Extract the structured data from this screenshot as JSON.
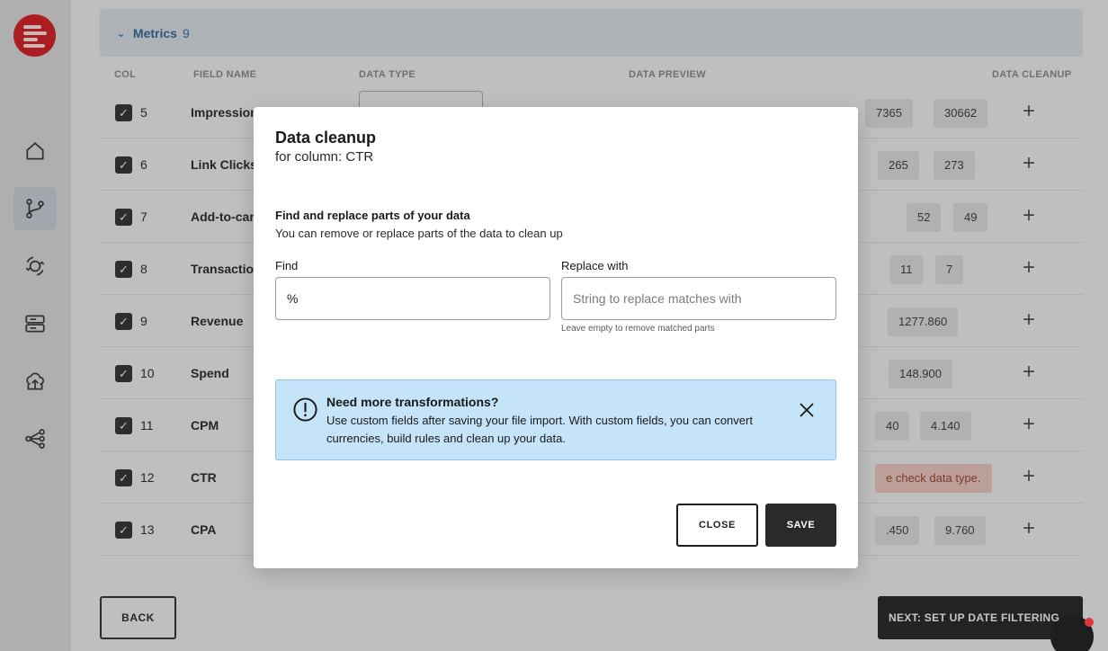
{
  "metrics_group": {
    "title": "Metrics",
    "count": "9"
  },
  "columns": {
    "col": "COL",
    "field_name": "FIELD NAME",
    "data_type": "DATA TYPE",
    "data_preview": "DATA PREVIEW",
    "data_cleanup": "DATA CLEANUP"
  },
  "rows": [
    {
      "num": "5",
      "name": "Impression",
      "preview": [
        "7365",
        "30662"
      ]
    },
    {
      "num": "6",
      "name": "Link Clicks",
      "preview": [
        "265",
        "273"
      ]
    },
    {
      "num": "7",
      "name": "Add-to-car",
      "preview": [
        "52",
        "49"
      ]
    },
    {
      "num": "8",
      "name": "Transactio",
      "preview": [
        "11",
        "7"
      ]
    },
    {
      "num": "9",
      "name": "Revenue",
      "preview": [
        "1277.860"
      ]
    },
    {
      "num": "10",
      "name": "Spend",
      "preview": [
        "148.900"
      ]
    },
    {
      "num": "11",
      "name": "CPM",
      "preview": [
        "40",
        "4.140"
      ]
    },
    {
      "num": "12",
      "name": "CTR",
      "warning": "e check data type."
    },
    {
      "num": "13",
      "name": "CPA",
      "preview": [
        ".450",
        "9.760"
      ]
    }
  ],
  "footer": {
    "back_label": "BACK",
    "next_label": "NEXT: SET UP DATE FILTERING"
  },
  "modal": {
    "title": "Data cleanup",
    "subtitle": "for column: CTR",
    "section_title": "Find and replace parts of your data",
    "section_desc": "You can remove or replace parts of the data to clean up",
    "find_label": "Find",
    "find_value": "%",
    "replace_label": "Replace with",
    "replace_placeholder": "String to replace matches with",
    "replace_help": "Leave empty to remove matched parts",
    "info_title": "Need more transformations?",
    "info_text": "Use custom fields after saving your file import. With custom fields, you can convert currencies, build rules and clean up your data.",
    "close_label": "CLOSE",
    "save_label": "SAVE"
  },
  "icons": {
    "logo": "brand-logo",
    "nav": [
      "home-icon",
      "branch-icon",
      "connections-icon",
      "storage-icon",
      "upload-icon",
      "workflow-icon"
    ],
    "info": "exclamation-circle-icon",
    "close": "close-icon",
    "chat": "chat-icon"
  },
  "colors": {
    "brand": "#c4161c",
    "info_bg": "#c6e4f9",
    "metrics_accent": "#2c5b8c",
    "primary_button": "#2a2a2a"
  }
}
